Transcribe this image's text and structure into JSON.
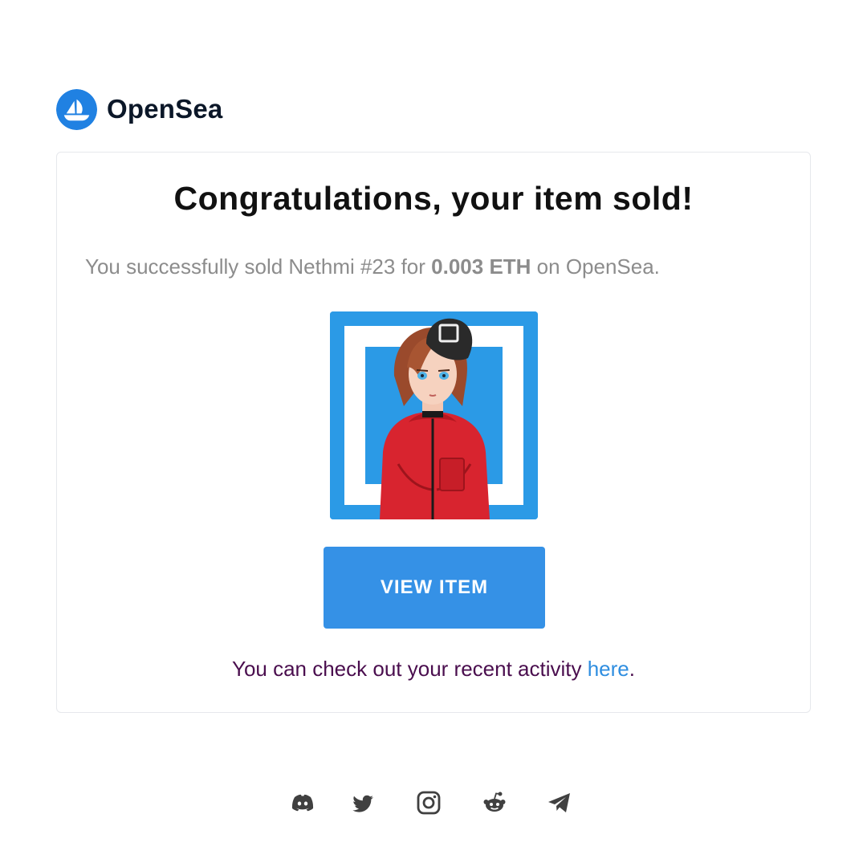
{
  "brand": {
    "name": "OpenSea",
    "logo_icon": "opensea-logo-icon",
    "color": "#2081e2"
  },
  "card": {
    "headline": "Congratulations, your item sold!",
    "summary": {
      "prefix": "You successfully sold Nethmi #23 for ",
      "price": "0.003 ETH",
      "suffix": " on OpenSea."
    },
    "item_image": "nft-artwork-image",
    "view_button_label": "VIEW ITEM",
    "activity": {
      "text": "You can check out your recent activity ",
      "link_label": "here",
      "end": "."
    }
  },
  "footer": {
    "social_icons": [
      "discord-icon",
      "twitter-icon",
      "instagram-icon",
      "reddit-icon",
      "telegram-icon"
    ]
  },
  "colors": {
    "button": "#3591e6",
    "link": "#2f8ee0",
    "activity_text": "#4a0e4e",
    "nft_background": "#2b9ae6"
  }
}
